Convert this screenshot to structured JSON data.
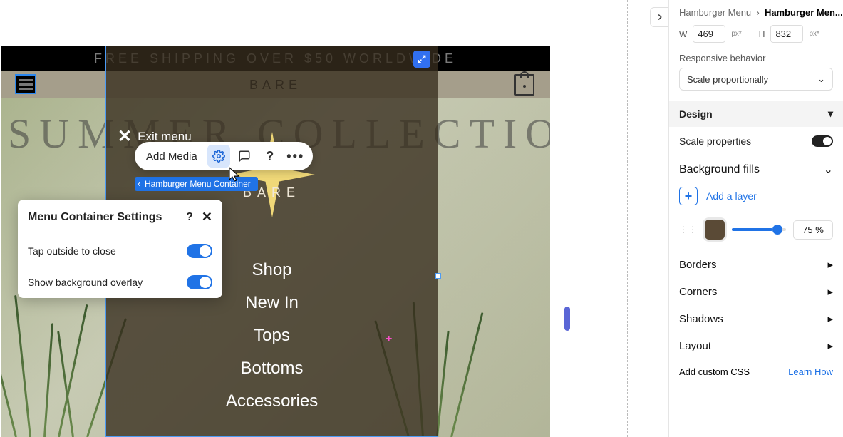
{
  "preview": {
    "banner": "FREE SHIPPING OVER $50 WORLDWIDE",
    "logo": "BARE",
    "hero": "SUMMER COLLECTION",
    "exit": "Exit menu",
    "menuLogo": "BARE",
    "items": [
      "Shop",
      "New In",
      "Tops",
      "Bottoms",
      "Accessories"
    ]
  },
  "toolbar": {
    "addMedia": "Add Media",
    "breadcrumbPill": "Hamburger Menu Container"
  },
  "settings": {
    "title": "Menu Container Settings",
    "row1": "Tap outside to close",
    "row2": "Show background overlay"
  },
  "inspector": {
    "crumb1": "Hamburger Menu",
    "crumb2": "Hamburger Men...",
    "wLabel": "W",
    "wVal": "469",
    "wUnit": "px*",
    "hLabel": "H",
    "hVal": "832",
    "hUnit": "px*",
    "respLabel": "Responsive behavior",
    "respVal": "Scale proportionally",
    "design": "Design",
    "scaleProps": "Scale properties",
    "bgFills": "Background fills",
    "addLayer": "Add a layer",
    "opacity": "75 %",
    "borders": "Borders",
    "corners": "Corners",
    "shadows": "Shadows",
    "layout": "Layout",
    "addCss": "Add custom CSS",
    "learn": "Learn How"
  }
}
